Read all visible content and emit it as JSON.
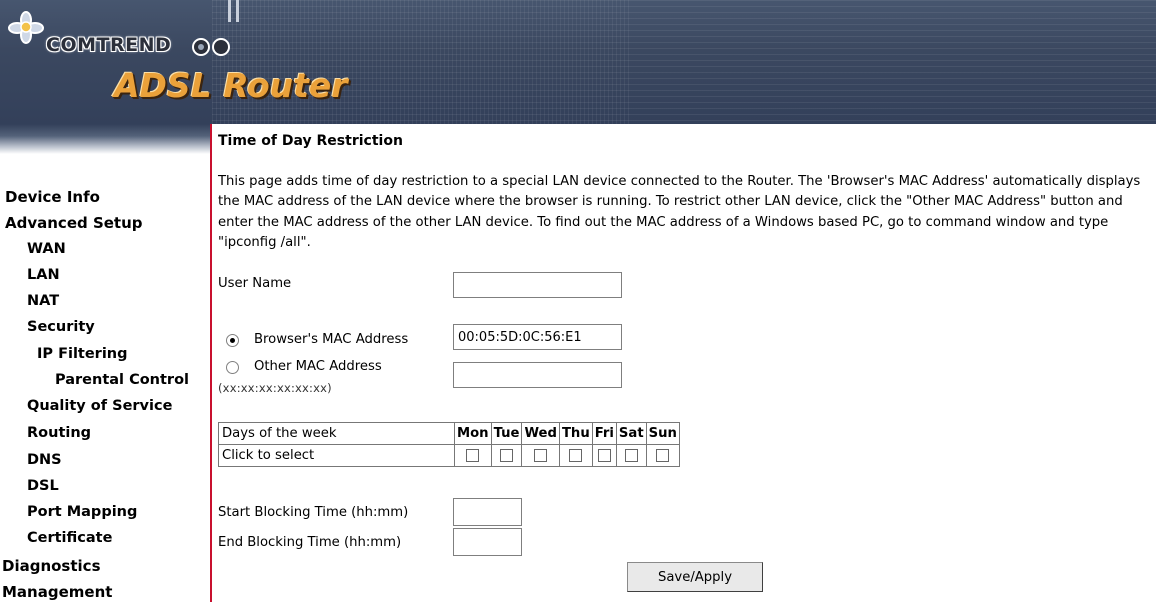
{
  "banner": {
    "brand": "COMTREND",
    "product": "ADSL Router"
  },
  "sidebar": {
    "items": [
      {
        "label": "Device Info",
        "level": 0
      },
      {
        "label": "Advanced Setup",
        "level": 0
      },
      {
        "label": "WAN",
        "level": 1
      },
      {
        "label": "LAN",
        "level": 1
      },
      {
        "label": "NAT",
        "level": 1
      },
      {
        "label": "Security",
        "level": 1
      },
      {
        "label": "IP Filtering",
        "level": 2
      },
      {
        "label": "Parental Control",
        "level": 2
      },
      {
        "label": "Quality of Service",
        "level": 1
      },
      {
        "label": "Routing",
        "level": 1
      },
      {
        "label": "DNS",
        "level": 1
      },
      {
        "label": "DSL",
        "level": 1
      },
      {
        "label": "Port Mapping",
        "level": 1
      },
      {
        "label": "Certificate",
        "level": 1
      },
      {
        "label": "Diagnostics",
        "level": 0
      },
      {
        "label": "Management",
        "level": 0
      }
    ]
  },
  "main": {
    "title": "Time of Day Restriction",
    "description": "This page adds time of day restriction to a special LAN device connected to the Router. The 'Browser's MAC Address' automatically displays the MAC address of the LAN device where the browser is running. To restrict other LAN device, click the \"Other MAC Address\" button and enter the MAC address of the other LAN device. To find out the MAC address of a Windows based PC, go to command window and type \"ipconfig /all\".",
    "user_name_label": "User Name",
    "user_name_value": "",
    "browser_mac_label": "Browser's MAC Address",
    "browser_mac_value": "00:05:5D:0C:56:E1",
    "browser_mac_selected": true,
    "other_mac_label": "Other MAC Address",
    "other_mac_hint": "(xx:xx:xx:xx:xx:xx)",
    "other_mac_value": "",
    "days_header": "Days of the week",
    "days_select_label": "Click to select",
    "days": [
      "Mon",
      "Tue",
      "Wed",
      "Thu",
      "Fri",
      "Sat",
      "Sun"
    ],
    "start_label": "Start Blocking Time (hh:mm)",
    "start_value": "",
    "end_label": "End Blocking Time (hh:mm)",
    "end_value": "",
    "save_label": "Save/Apply"
  },
  "colors": {
    "banner_bg": "#3b4860",
    "accent_red": "#c8102e",
    "product_orange": "#eaa13a"
  }
}
